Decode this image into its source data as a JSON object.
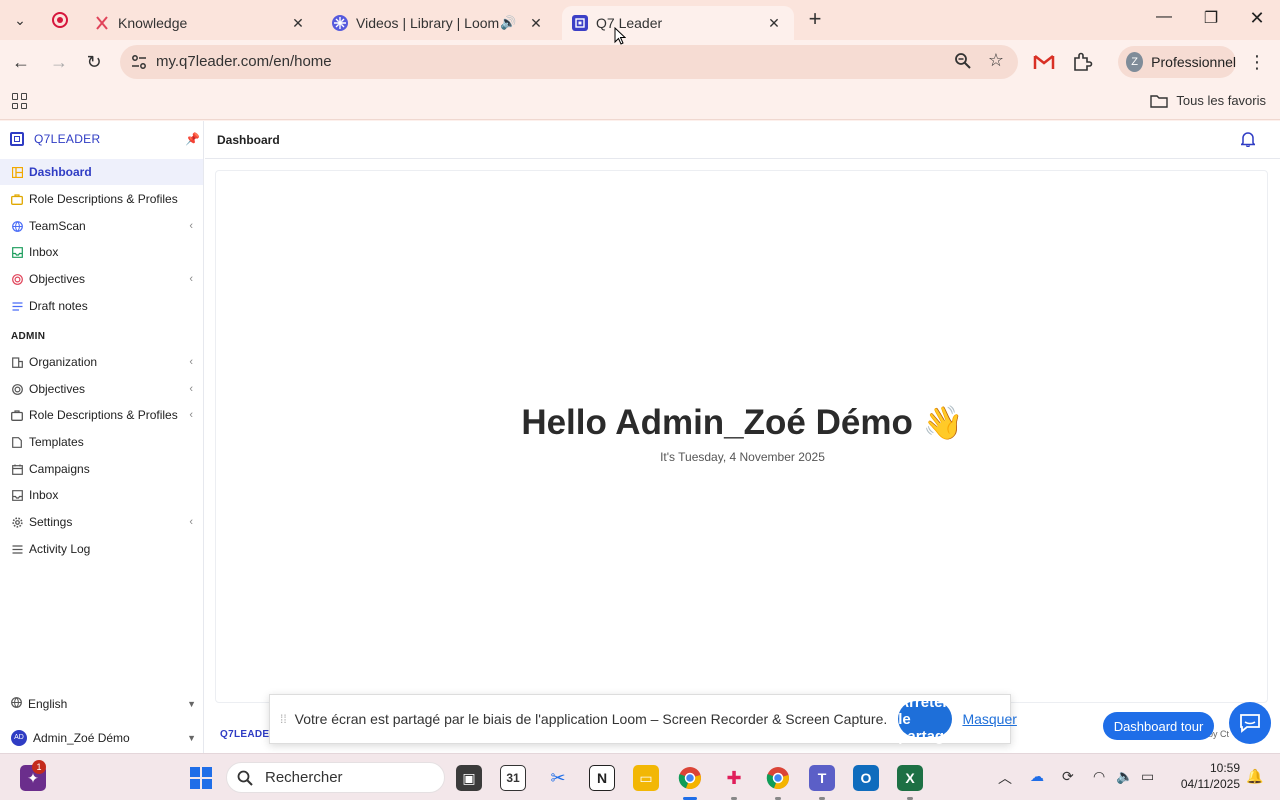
{
  "browser": {
    "tabs": [
      {
        "title": "Knowledge",
        "favicon": "knowledge-icon"
      },
      {
        "title": "Videos | Library | Loom",
        "favicon": "loom-icon"
      },
      {
        "title": "Q7 Leader",
        "favicon": "q7-icon",
        "active": true
      }
    ],
    "url": "my.q7leader.com/en/home",
    "profile_initial": "Z",
    "profile_label": "Professionnel",
    "all_bookmarks": "Tous les favoris"
  },
  "sidebar": {
    "brand": "Q7LEADER",
    "items": [
      {
        "label": "Dashboard",
        "icon": "dashboard-icon",
        "color": "#f2a900",
        "active": true
      },
      {
        "label": "Role Descriptions & Profiles",
        "icon": "briefcase-icon",
        "color": "#e0a800"
      },
      {
        "label": "TeamScan",
        "icon": "globe-icon",
        "color": "#4a6cf7",
        "chevron": true
      },
      {
        "label": "Inbox",
        "icon": "inbox-icon",
        "color": "#1a9c5b"
      },
      {
        "label": "Objectives",
        "icon": "target-icon",
        "color": "#e0445a",
        "chevron": true
      },
      {
        "label": "Draft notes",
        "icon": "notes-icon",
        "color": "#4a6cf7"
      }
    ],
    "admin_heading": "ADMIN",
    "admin_items": [
      {
        "label": "Organization",
        "icon": "organization-icon",
        "chevron": true
      },
      {
        "label": "Objectives",
        "icon": "target-icon",
        "chevron": true
      },
      {
        "label": "Role Descriptions & Profiles",
        "icon": "briefcase-icon",
        "chevron": true
      },
      {
        "label": "Templates",
        "icon": "document-icon"
      },
      {
        "label": "Campaigns",
        "icon": "calendar-icon"
      },
      {
        "label": "Inbox",
        "icon": "inbox-icon"
      },
      {
        "label": "Settings",
        "icon": "gear-icon",
        "chevron": true
      },
      {
        "label": "Activity Log",
        "icon": "list-icon"
      }
    ],
    "language": "English",
    "user_initials": "AD",
    "user_name": "Admin_Zoé Démo"
  },
  "header": {
    "breadcrumb": "Dashboard"
  },
  "main": {
    "greeting": "Hello Admin_Zoé Démo",
    "greeting_emoji": "👋",
    "date": "It's Tuesday, 4 November 2025"
  },
  "footer": {
    "brand": "Q7LEADER",
    "powered_by": "by Ct"
  },
  "share_bar": {
    "message": "Votre écran est partagé par le biais de l'application Loom – Screen Recorder & Screen Capture.",
    "stop_label": "Arrêter le partage",
    "hide_label": "Masquer"
  },
  "tour_button": "Dashboard tour",
  "taskbar": {
    "search_placeholder": "Rechercher",
    "notification_count": "1",
    "time": "10:59",
    "date": "04/11/2025"
  },
  "colors": {
    "accent": "#2f3cc4",
    "primary_button": "#1f6ee8",
    "browser_chrome": "#fbe4dc"
  }
}
